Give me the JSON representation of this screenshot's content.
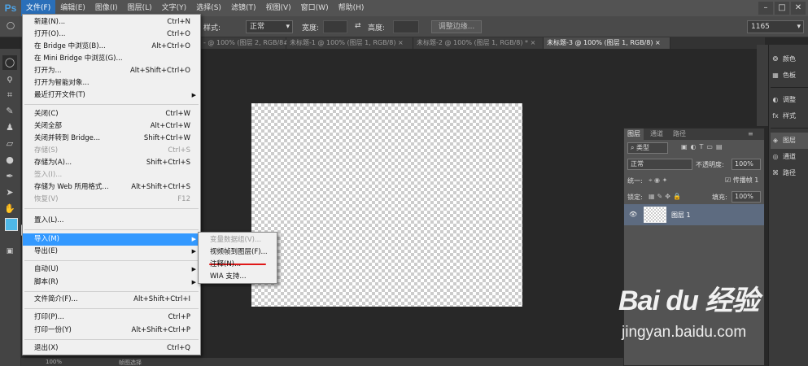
{
  "app": {
    "logo": "Ps"
  },
  "menubar": {
    "items": [
      "文件(F)",
      "编辑(E)",
      "图像(I)",
      "图层(L)",
      "文字(Y)",
      "选择(S)",
      "滤镜(T)",
      "视图(V)",
      "窗口(W)",
      "帮助(H)"
    ],
    "window_buttons": [
      "–",
      "□",
      "✕"
    ]
  },
  "options": {
    "style_label": "样式:",
    "style_value": "正常",
    "width_label": "宽度:",
    "height_label": "高度:",
    "refine_edge": "调整边缘...",
    "workspace_value": "1165"
  },
  "tabs": [
    "- @ 100% (图层 2, RGB/8#) *",
    "未标题-1 @ 100% (图层 1, RGB/8)",
    "未标题-2 @ 100% (图层 1, RGB/8) *",
    "未标题-3 @ 100% (图层 1, RGB/8)"
  ],
  "tab_close": "×",
  "file_menu": {
    "items": [
      {
        "label": "新建(N)...",
        "shortcut": "Ctrl+N"
      },
      {
        "label": "打开(O)...",
        "shortcut": "Ctrl+O"
      },
      {
        "label": "在 Bridge 中浏览(B)...",
        "shortcut": "Alt+Ctrl+O"
      },
      {
        "label": "在 Mini Bridge 中浏览(G)...",
        "shortcut": ""
      },
      {
        "label": "打开为...",
        "shortcut": "Alt+Shift+Ctrl+O"
      },
      {
        "label": "打开为智能对象...",
        "shortcut": ""
      },
      {
        "label": "最近打开文件(T)",
        "shortcut": ""
      },
      {
        "label": "关闭(C)",
        "shortcut": "Ctrl+W"
      },
      {
        "label": "关闭全部",
        "shortcut": "Alt+Ctrl+W"
      },
      {
        "label": "关闭并转到 Bridge...",
        "shortcut": "Shift+Ctrl+W"
      },
      {
        "label": "存储(S)",
        "shortcut": "Ctrl+S"
      },
      {
        "label": "存储为(A)...",
        "shortcut": "Shift+Ctrl+S"
      },
      {
        "label": "签入(I)...",
        "shortcut": ""
      },
      {
        "label": "存储为 Web 所用格式...",
        "shortcut": "Alt+Shift+Ctrl+S"
      },
      {
        "label": "恢复(V)",
        "shortcut": "F12"
      },
      {
        "label": "置入(L)...",
        "shortcut": ""
      },
      {
        "label": "导入(M)",
        "shortcut": ""
      },
      {
        "label": "导出(E)",
        "shortcut": ""
      },
      {
        "label": "自动(U)",
        "shortcut": ""
      },
      {
        "label": "脚本(R)",
        "shortcut": ""
      },
      {
        "label": "文件简介(F)...",
        "shortcut": "Alt+Shift+Ctrl+I"
      },
      {
        "label": "打印(P)...",
        "shortcut": "Ctrl+P"
      },
      {
        "label": "打印一份(Y)",
        "shortcut": "Alt+Shift+Ctrl+P"
      },
      {
        "label": "退出(X)",
        "shortcut": "Ctrl+Q"
      }
    ]
  },
  "import_submenu": {
    "items": [
      "变量数据组(V)...",
      "视频帧到图层(F)...",
      "注释(N)...",
      "WIA 支持..."
    ]
  },
  "dock": {
    "items": [
      "颜色",
      "色板",
      "调整",
      "样式",
      "图层",
      "通道",
      "路径"
    ]
  },
  "layers_panel": {
    "tabs": [
      "图层",
      "通道",
      "路径"
    ],
    "filter_kind": "类型",
    "blend_mode": "正常",
    "opacity_label": "不透明度:",
    "opacity_value": "100%",
    "unify_label": "统一:",
    "propagate_label": "传播帧 1",
    "lock_label": "锁定:",
    "fill_label": "填充:",
    "fill_value": "100%",
    "layer_name": "图层 1"
  },
  "statusbar": {
    "zoom": "100%",
    "hint": "帧图选择"
  },
  "watermark": {
    "logo": "Bai du 经验",
    "url": "jingyan.baidu.com"
  },
  "colors": {
    "accent": "#3399ff",
    "menu_bg": "#f0f0f0",
    "highlight_underline": "#e01818",
    "fg_swatch": "#4fb8e8"
  }
}
